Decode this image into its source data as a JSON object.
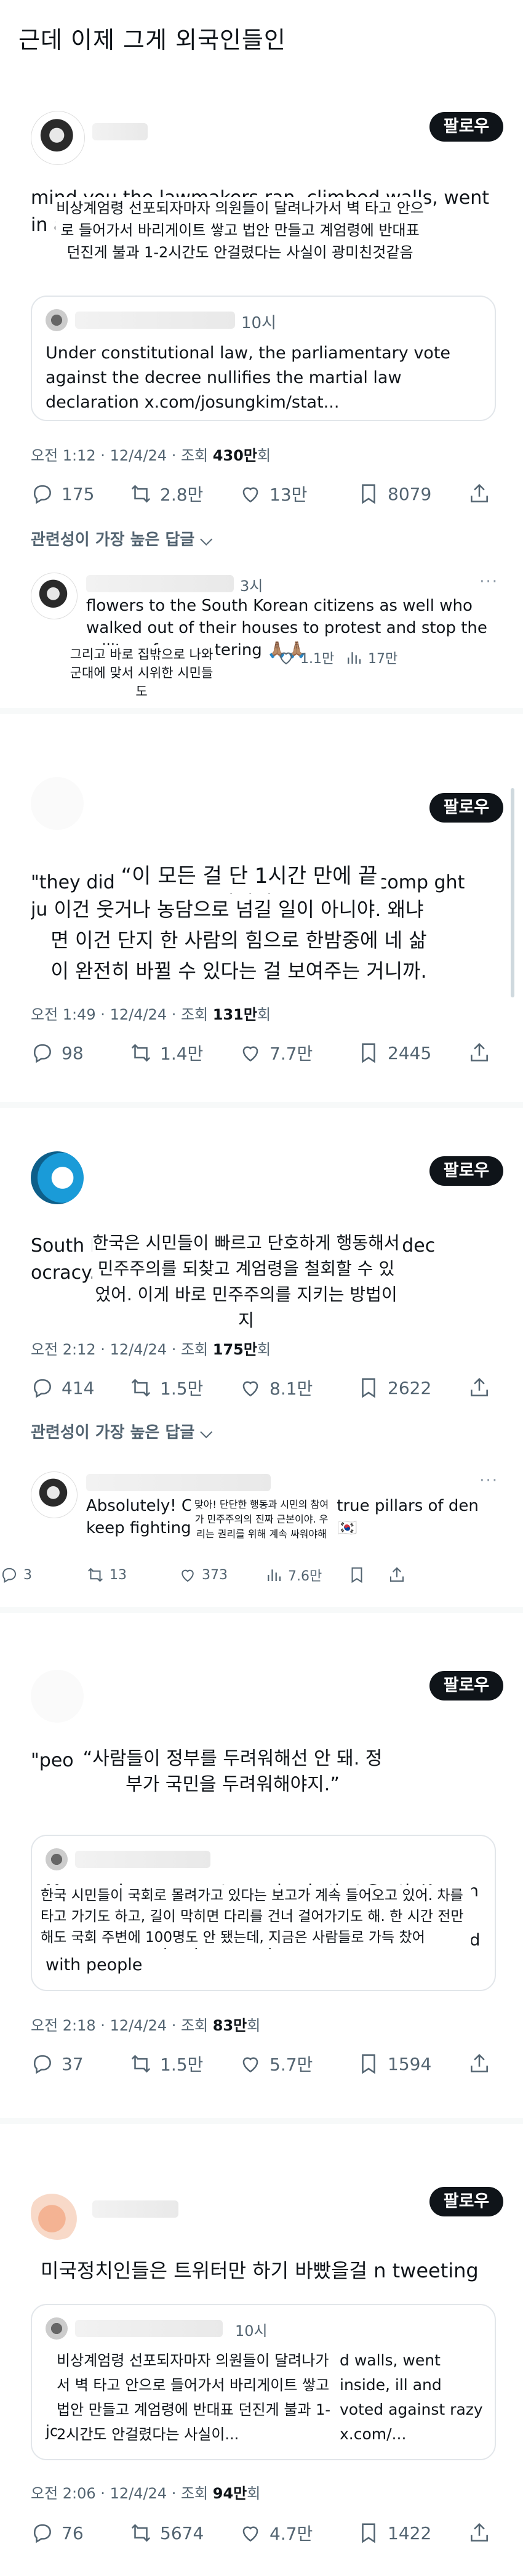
{
  "page_title": "근데 이제 그게 외국인들인",
  "follow_label": "팔로우",
  "sort_label": "관련성이 가장 높은 답글 ⌵",
  "icons": {
    "reply": "reply-icon",
    "repost": "repost-icon",
    "like": "heart-icon",
    "views": "views-icon",
    "bookmark": "bookmark-icon",
    "share": "share-icon"
  },
  "posts": [
    {
      "body_visible": "mind you the lawmakers ran, climbed walls, went in                                                     and voted ag                                                                     azy",
      "translation": "비상계엄령 선포되자마자 의원들이 달려나가서 벽 타고 안으로 들어가서 바리게이트 쌓고 법안 만들고 계엄령에 반대표 던진게 불과 1-2시간도 안걸렸다는 사실이 광미친것같음",
      "quote": {
        "handle": "10시",
        "text": "Under constitutional law, the parliamentary vote against the decree nullifies the martial law declaration x.com/josungkim/stat..."
      },
      "time": "오전 1:12 · 12/4/24 · 조회 ",
      "views": "430만",
      "views_suffix": "회",
      "stats": {
        "replies": "175",
        "reposts": "2.8만",
        "likes": "13만",
        "bookmarks": "8079"
      },
      "reply": {
        "time": "3시",
        "text": "flowers to the South Korean citizens as well who walked out of their houses to protest and stop the military from entering 🙏🏽🙏🏽",
        "translation": "그리고 바로 집밖으로 나와 군대에 맞서 시위한 시민들도",
        "likes": "1.1만",
        "views": "17만"
      }
    },
    {
      "body_visible": "\"they did                                                                                   nothing to laugh                                                                         ur life can comp                                                                           ght just c",
      "translation_1": "“이 모든 걸 단 1시간 만에 끝내겠어”",
      "translation_2": "이건 웃거나 농담으로 넘길 일이 아니야. 왜냐면 이건 단지 한 사람의 힘으로 한밤중에 네 삶이 완전히 바뀔 수 있다는 걸 보여주는 거니까.",
      "time": "오전 1:49 · 12/4/24 · 조회 ",
      "views": "131만",
      "views_suffix": "회",
      "stats": {
        "replies": "98",
        "reposts": "1.4만",
        "likes": "7.7만",
        "bookmarks": "2445"
      }
    },
    {
      "body_visible": "South K                                                                           and undo the ma                                                                           d quickly and dec                                                                         ocracy.",
      "translation": "한국은 시민들이 빠르고 단호하게 행동해서 민주주의를 되찾고 계엄령을 철회할 수 있었어. 이게 바로 민주주의를 지키는 방법이지",
      "time": "오전 2:12 · 12/4/24 · 조회 ",
      "views": "175만",
      "views_suffix": "회",
      "stats": {
        "replies": "414",
        "reposts": "1.5만",
        "likes": "8.1만",
        "bookmarks": "2622"
      },
      "reply": {
        "text": "Absolutely! C                                                  agement are the true pillars of den                                                  keep fighting for our rights! ✊ 🇰🇷",
        "translation": "맞아! 단단한 행동과 시민의 참여가 민주주의의 진짜 근본이야. 우리는 권리를 위해 계속 싸워야해",
        "replies": "3",
        "reposts": "13",
        "likes": "373",
        "views": "7.6만"
      }
    },
    {
      "body_visible": "\"peo                                                                   ernment. govern                                                                   people.\"",
      "translation": "“사람들이 정부를 두려워해선 안 돼. 정부가 국민을 두려워해야지.”",
      "quote": {
        "text_visible": "More and more reports coming in that South Korean                                         across bridges. Less than an hour ago there was less than 100 people near parliament. Now it's filled with people",
        "translation": "한국 시민들이 국회로 몰려가고 있다는 보고가 계속 들어오고 있어. 차를 타고 가기도 하고, 길이 막히면 다리를 건너 걸어가기도 해. 한 시간 전만 해도 국회 주변에 100명도 안 됐는데, 지금은 사람들로 가득 찼어"
      },
      "time": "오전 2:18 · 12/4/24 · 조회 ",
      "views": "83만",
      "views_suffix": "회",
      "stats": {
        "replies": "37",
        "reposts": "1.5만",
        "likes": "5.7만",
        "bookmarks": "1594"
      }
    },
    {
      "body_visible": "미국정치인들은 트위터만 하기 바빴을걸 n tweeting",
      "quote": {
        "handle": "10시",
        "text_visible": "d walls, went inside, ill and voted against razy x.com/...",
        "translation": "비상계엄령 선포되자마자 의원들이 달려나가서 벽 타고 안으로 들어가서 바리게이트 쌓고 법안 만들고 계엄령에 반대표 던진게 불과 1-2시간도 안걸렸다는 사실이...",
        "prefix": "jo"
      },
      "time": "오전 2:06 · 12/4/24 · 조회 ",
      "views": "94만",
      "views_suffix": "회",
      "stats": {
        "replies": "76",
        "reposts": "5674",
        "likes": "4.7만",
        "bookmarks": "1422"
      }
    }
  ]
}
